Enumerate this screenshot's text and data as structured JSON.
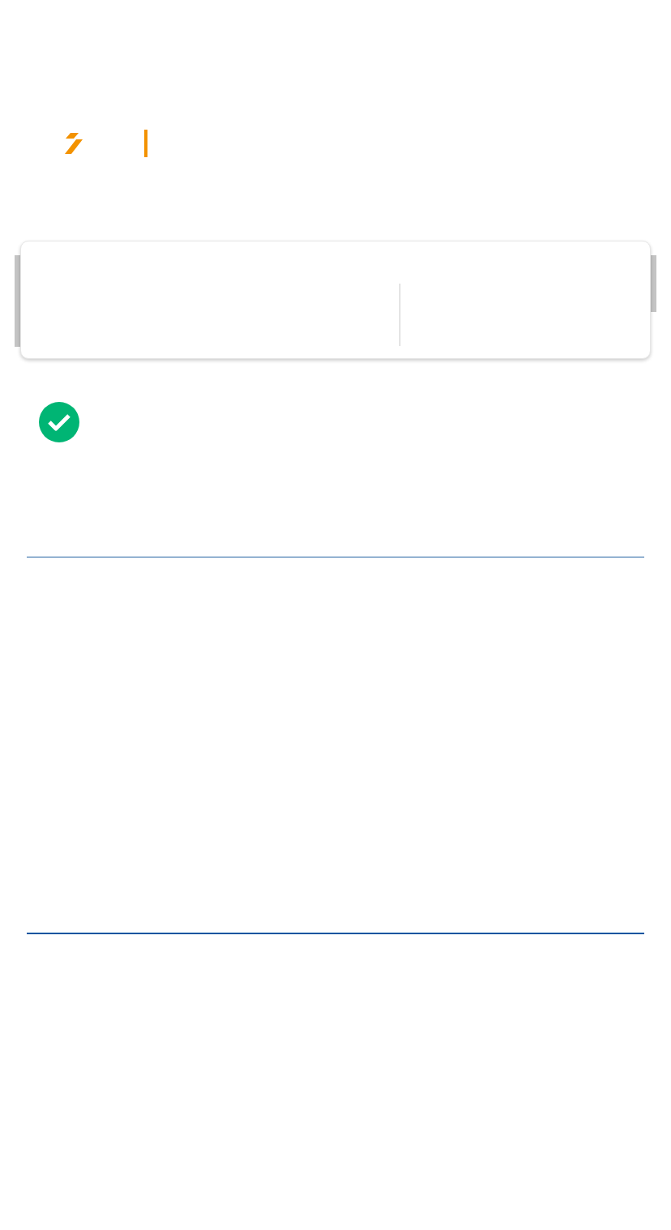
{
  "status": {
    "kind": "success"
  }
}
